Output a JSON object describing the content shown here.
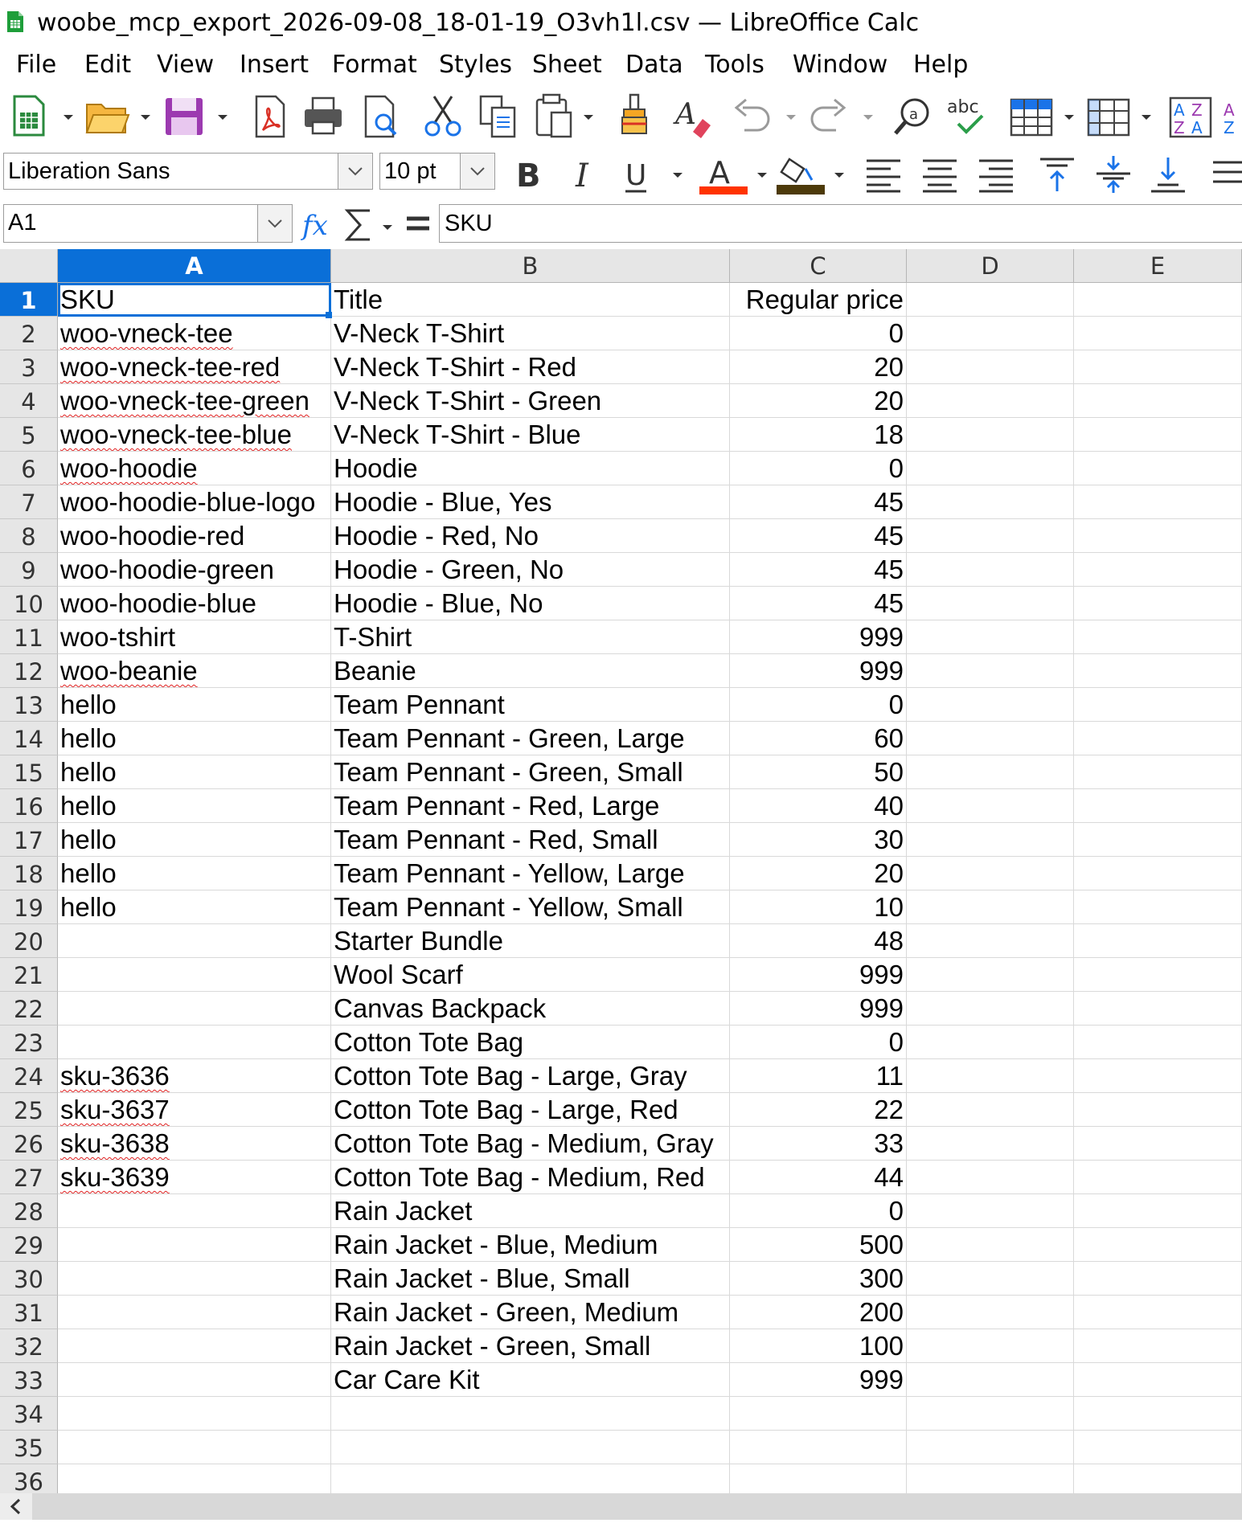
{
  "window": {
    "title": "woobe_mcp_export_2026-09-08_18-01-19_O3vh1l.csv — LibreOffice Calc"
  },
  "menu": [
    "File",
    "Edit",
    "View",
    "Insert",
    "Format",
    "Styles",
    "Sheet",
    "Data",
    "Tools",
    "Window",
    "Help"
  ],
  "toolbar2": {
    "font_name": "Liberation Sans",
    "font_size": "10 pt",
    "bold_label": "B",
    "italic_label": "I",
    "underline_label": "U"
  },
  "formula_bar": {
    "name_box": "A1",
    "content": "SKU"
  },
  "colors": {
    "selection": "#0a6fd8",
    "font_color": "#ff3300",
    "highlight": "#4d3a0a",
    "spell": "#e02020"
  },
  "sheet": {
    "columns": [
      "A",
      "B",
      "C",
      "D",
      "E"
    ],
    "rows": [
      {
        "n": "1",
        "a": "SKU",
        "b": "Title",
        "c": "Regular price"
      },
      {
        "n": "2",
        "a": "woo-vneck-tee",
        "b": "V-Neck T-Shirt",
        "c": "0"
      },
      {
        "n": "3",
        "a": "woo-vneck-tee-red",
        "b": "V-Neck T-Shirt - Red",
        "c": "20"
      },
      {
        "n": "4",
        "a": "woo-vneck-tee-green",
        "b": "V-Neck T-Shirt - Green",
        "c": "20"
      },
      {
        "n": "5",
        "a": "woo-vneck-tee-blue",
        "b": "V-Neck T-Shirt - Blue",
        "c": "18"
      },
      {
        "n": "6",
        "a": "woo-hoodie",
        "b": "Hoodie",
        "c": "0"
      },
      {
        "n": "7",
        "a": "woo-hoodie-blue-logo",
        "b": "Hoodie - Blue, Yes",
        "c": "45"
      },
      {
        "n": "8",
        "a": "woo-hoodie-red",
        "b": "Hoodie - Red, No",
        "c": "45"
      },
      {
        "n": "9",
        "a": "woo-hoodie-green",
        "b": "Hoodie - Green, No",
        "c": "45"
      },
      {
        "n": "10",
        "a": "woo-hoodie-blue",
        "b": "Hoodie - Blue, No",
        "c": "45"
      },
      {
        "n": "11",
        "a": "woo-tshirt",
        "b": "T-Shirt",
        "c": "999"
      },
      {
        "n": "12",
        "a": "woo-beanie",
        "b": "Beanie",
        "c": "999"
      },
      {
        "n": "13",
        "a": "hello",
        "b": "Team Pennant",
        "c": "0"
      },
      {
        "n": "14",
        "a": "hello",
        "b": "Team Pennant - Green, Large",
        "c": "60"
      },
      {
        "n": "15",
        "a": "hello",
        "b": "Team Pennant - Green, Small",
        "c": "50"
      },
      {
        "n": "16",
        "a": "hello",
        "b": "Team Pennant - Red, Large",
        "c": "40"
      },
      {
        "n": "17",
        "a": "hello",
        "b": "Team Pennant - Red, Small",
        "c": "30"
      },
      {
        "n": "18",
        "a": "hello",
        "b": "Team Pennant - Yellow, Large",
        "c": "20"
      },
      {
        "n": "19",
        "a": "hello",
        "b": "Team Pennant - Yellow, Small",
        "c": "10"
      },
      {
        "n": "20",
        "a": "",
        "b": "Starter Bundle",
        "c": "48"
      },
      {
        "n": "21",
        "a": "",
        "b": "Wool Scarf",
        "c": "999"
      },
      {
        "n": "22",
        "a": "",
        "b": "Canvas Backpack",
        "c": "999"
      },
      {
        "n": "23",
        "a": "",
        "b": "Cotton Tote Bag",
        "c": "0"
      },
      {
        "n": "24",
        "a": "sku-3636",
        "b": "Cotton Tote Bag - Large, Gray",
        "c": "11"
      },
      {
        "n": "25",
        "a": "sku-3637",
        "b": "Cotton Tote Bag - Large, Red",
        "c": "22"
      },
      {
        "n": "26",
        "a": "sku-3638",
        "b": "Cotton Tote Bag - Medium, Gray",
        "c": "33"
      },
      {
        "n": "27",
        "a": "sku-3639",
        "b": "Cotton Tote Bag - Medium, Red",
        "c": "44"
      },
      {
        "n": "28",
        "a": "",
        "b": "Rain Jacket",
        "c": "0"
      },
      {
        "n": "29",
        "a": "",
        "b": "Rain Jacket - Blue, Medium",
        "c": "500"
      },
      {
        "n": "30",
        "a": "",
        "b": "Rain Jacket - Blue, Small",
        "c": "300"
      },
      {
        "n": "31",
        "a": "",
        "b": "Rain Jacket - Green, Medium",
        "c": "200"
      },
      {
        "n": "32",
        "a": "",
        "b": "Rain Jacket - Green, Small",
        "c": "100"
      },
      {
        "n": "33",
        "a": "",
        "b": "Car Care Kit",
        "c": "999"
      },
      {
        "n": "34",
        "a": "",
        "b": "",
        "c": ""
      },
      {
        "n": "35",
        "a": "",
        "b": "",
        "c": ""
      },
      {
        "n": "36",
        "a": "",
        "b": "",
        "c": ""
      }
    ],
    "spellcheck_flagged_rows": [
      1,
      2,
      3,
      4,
      5,
      11,
      23,
      24,
      25,
      26
    ]
  }
}
